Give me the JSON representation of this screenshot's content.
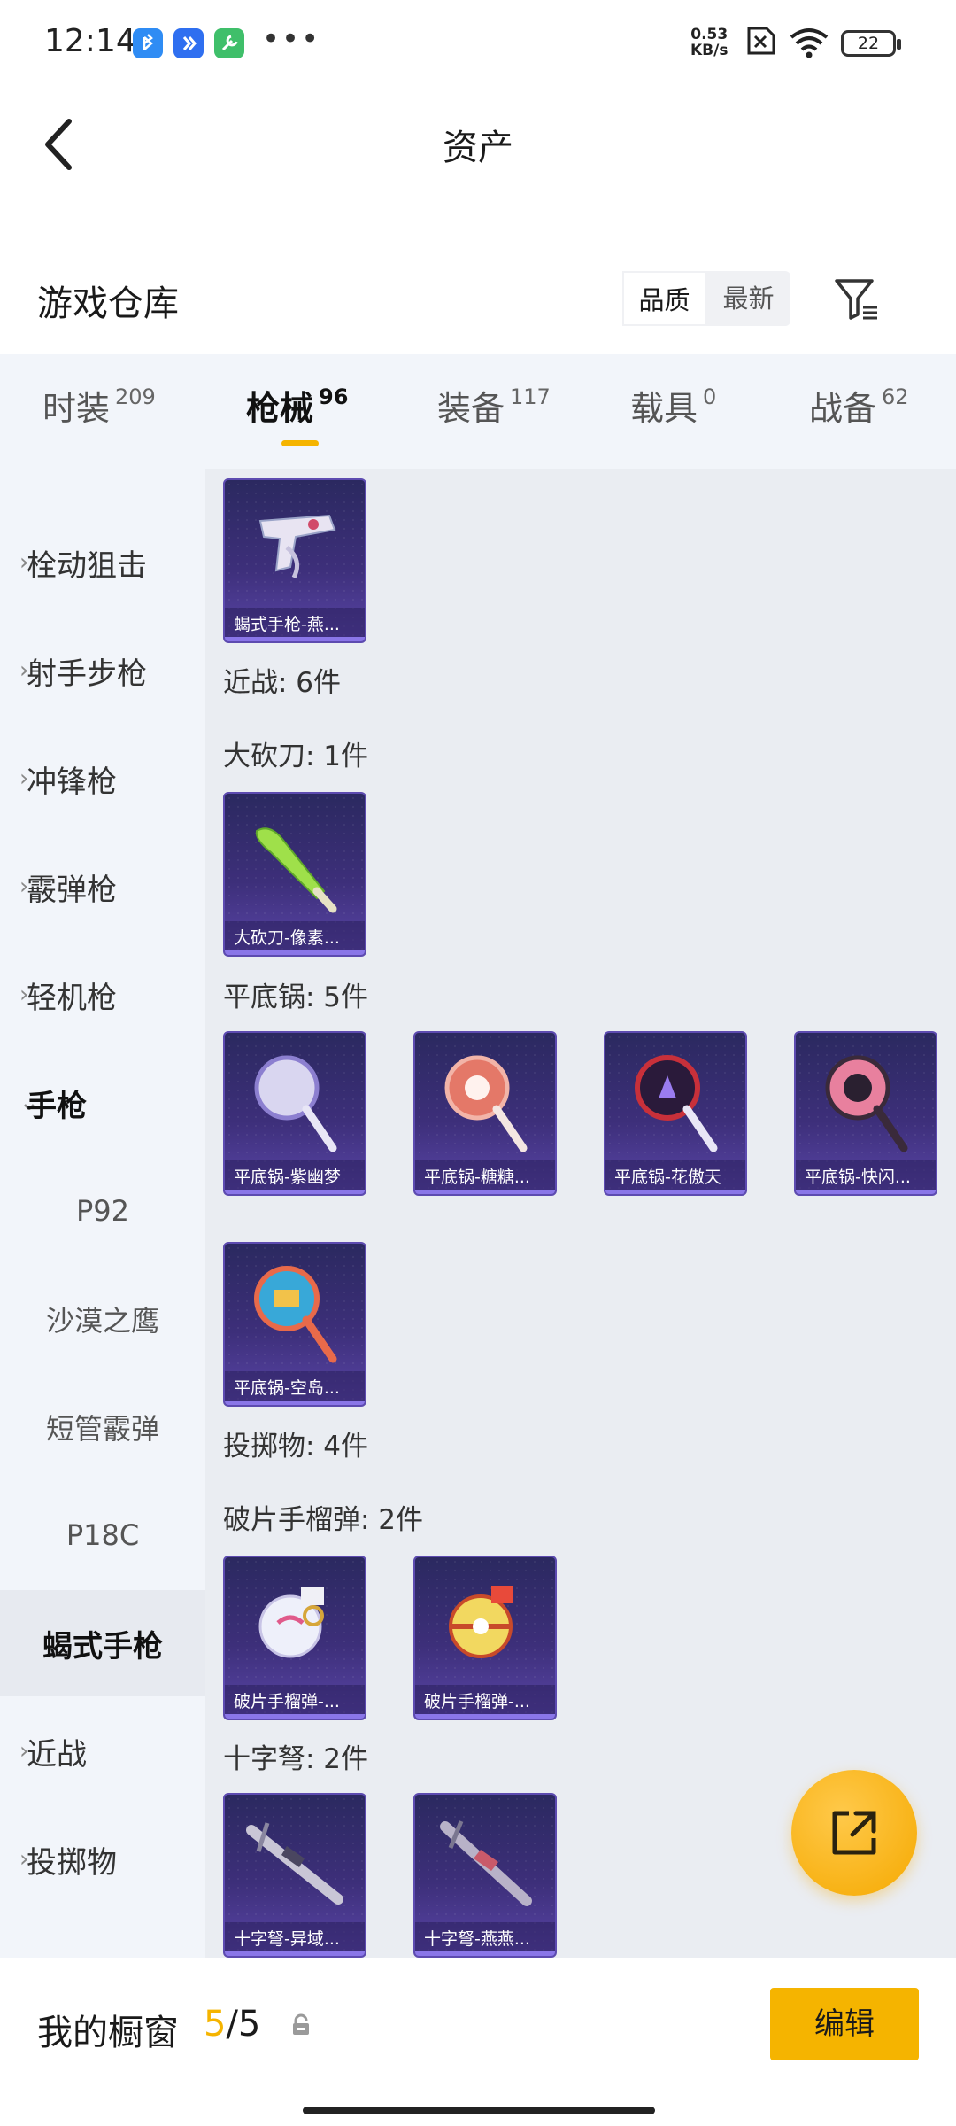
{
  "status_bar": {
    "time": "12:14",
    "speed_value": "0.53",
    "speed_unit": "KB/s",
    "battery": "22"
  },
  "header": {
    "title": "资产",
    "back_icon": "chevron-left-icon"
  },
  "warehouse": {
    "title": "游戏仓库",
    "sort_options": [
      "品质",
      "最新"
    ],
    "active_sort": "品质"
  },
  "tabs": [
    {
      "label": "时装",
      "count": "209"
    },
    {
      "label": "枪械",
      "count": "96"
    },
    {
      "label": "装备",
      "count": "117"
    },
    {
      "label": "载具",
      "count": "0"
    },
    {
      "label": "战备",
      "count": "62"
    }
  ],
  "active_tab": "枪械",
  "categories": [
    {
      "label": "栓动狙击",
      "type": "collapsed"
    },
    {
      "label": "射手步枪",
      "type": "collapsed"
    },
    {
      "label": "冲锋枪",
      "type": "collapsed"
    },
    {
      "label": "霰弹枪",
      "type": "collapsed"
    },
    {
      "label": "轻机枪",
      "type": "collapsed"
    },
    {
      "label": "手枪",
      "type": "expanded"
    },
    {
      "label": "P92",
      "type": "sub"
    },
    {
      "label": "沙漠之鹰",
      "type": "sub"
    },
    {
      "label": "短管霰弹",
      "type": "sub"
    },
    {
      "label": "P18C",
      "type": "sub"
    },
    {
      "label": "蝎式手枪",
      "type": "selected"
    },
    {
      "label": "近战",
      "type": "collapsed"
    },
    {
      "label": "投掷物",
      "type": "collapsed"
    }
  ],
  "content": {
    "labels": {
      "melee": "近战: 6件",
      "machete": "大砍刀: 1件",
      "pan": "平底锅: 5件",
      "throwables": "投掷物: 4件",
      "frag": "破片手榴弹: 2件",
      "crossbow": "十字弩: 2件"
    },
    "items": {
      "scorpion": "蝎式手枪-燕...",
      "machete": "大砍刀-像素...",
      "pan1": "平底锅-紫幽梦",
      "pan2": "平底锅-糖糖...",
      "pan3": "平底锅-花傲天",
      "pan4": "平底锅-快闪...",
      "pan5": "平底锅-空岛...",
      "frag1": "破片手榴弹-...",
      "frag2": "破片手榴弹-...",
      "crossbow1": "十字弩-异域...",
      "crossbow2": "十字弩-燕燕..."
    }
  },
  "bottom": {
    "window_label": "我的橱窗",
    "window_current": "5",
    "window_total": "/5",
    "edit_label": "编辑"
  },
  "colors": {
    "accent": "#f5b400",
    "card_bg": "#3d2f7a",
    "tab_bg": "#f2f5fa",
    "content_bg": "#eaedf2"
  }
}
